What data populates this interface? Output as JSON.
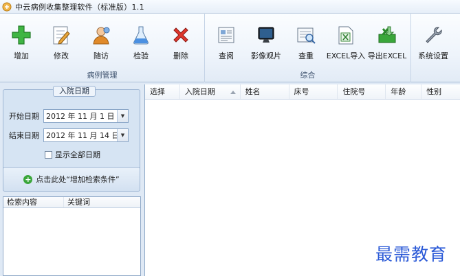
{
  "window": {
    "title": "中云病例收集整理软件（标准版）1.1"
  },
  "ribbon": {
    "groups": [
      {
        "label": "病例管理",
        "tools": [
          {
            "label": "增加",
            "icon": "add-icon"
          },
          {
            "label": "修改",
            "icon": "edit-icon"
          },
          {
            "label": "随访",
            "icon": "follow-up-icon"
          },
          {
            "label": "检验",
            "icon": "flask-icon"
          },
          {
            "label": "删除",
            "icon": "delete-icon"
          }
        ]
      },
      {
        "label": "综合",
        "tools": [
          {
            "label": "查阅",
            "icon": "document-icon"
          },
          {
            "label": "影像观片",
            "icon": "monitor-icon"
          },
          {
            "label": "查重",
            "icon": "duplicate-check-icon"
          },
          {
            "label": "EXCEL导入",
            "icon": "excel-import-icon"
          },
          {
            "label": "导出EXCEL",
            "icon": "excel-export-icon"
          }
        ]
      },
      {
        "label": "",
        "tools": [
          {
            "label": "系统设置",
            "icon": "wrench-icon"
          }
        ]
      }
    ]
  },
  "date_filter": {
    "legend": "入院日期",
    "start_label": "开始日期",
    "start_value": "2012 年 11 月 1 日",
    "end_label": "结束日期",
    "end_value": "2012 年 11 月 14 日",
    "show_all_label": "显示全部日期",
    "show_all_checked": false
  },
  "add_condition": {
    "label": "点击此处“增加检索条件”"
  },
  "search_table": {
    "columns": [
      "检索内容",
      "关键词"
    ]
  },
  "grid": {
    "columns": [
      "选择",
      "入院日期",
      "姓名",
      "床号",
      "住院号",
      "年龄",
      "性别"
    ],
    "sorted_column": "入院日期"
  },
  "watermark": "最需教育",
  "colors": {
    "ribbon_bg": "#eef4fb",
    "panel_bg": "#d6e4f3",
    "accent": "#2b5ad7"
  }
}
